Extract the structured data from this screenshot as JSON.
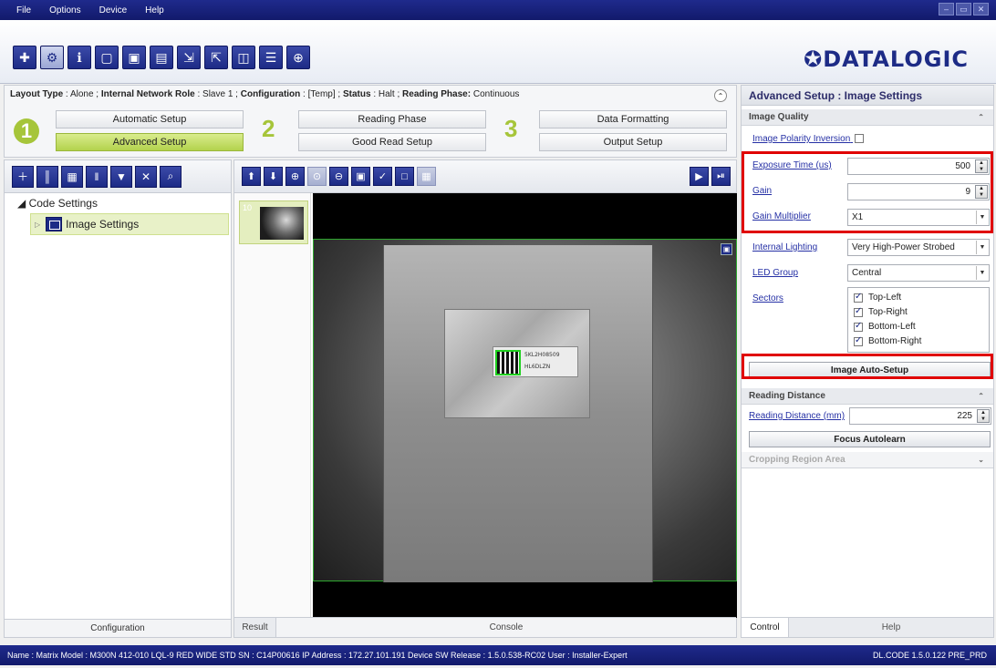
{
  "menu": [
    "File",
    "Options",
    "Device",
    "Help"
  ],
  "brand": {
    "logo": "✪DATALOGIC",
    "color": "#1d2b86",
    "accent": "#a6c53a"
  },
  "toolbar": {
    "icons": [
      "crosshair-icon",
      "settings-icon",
      "info-icon",
      "window-icon",
      "monitor-icon",
      "monitor-settings-icon",
      "export-icon",
      "import-icon",
      "device-icon",
      "network-icon",
      "target-icon"
    ]
  },
  "info": {
    "layout_type_label": "Layout Type",
    "layout_type": "Alone",
    "network_role_label": "Internal Network Role",
    "network_role": "Slave 1",
    "configuration_label": "Configuration",
    "configuration": "[Temp]",
    "status_label": "Status",
    "status": "Halt",
    "reading_phase_label": "Reading Phase:",
    "reading_phase": "Continuous"
  },
  "wizard": {
    "step1": "1",
    "step2": "2",
    "step3": "3",
    "automatic_setup": "Automatic Setup",
    "advanced_setup": "Advanced Setup",
    "reading_phase": "Reading Phase",
    "good_read_setup": "Good Read Setup",
    "data_formatting": "Data Formatting",
    "output_setup": "Output Setup"
  },
  "tree": {
    "root": "Code Settings",
    "item": "Image Settings",
    "footer": "Configuration"
  },
  "image_panel": {
    "thumb_number": "10",
    "label_line1": "5KL2H08509",
    "label_line2": "HL6DLZN",
    "result_tab": "Result",
    "console_tab": "Console"
  },
  "right": {
    "title": "Advanced Setup : Image Settings",
    "image_quality": "Image Quality",
    "polarity": "Image Polarity Inversion",
    "exposure_label": "Exposure Time (us)",
    "exposure_value": "500",
    "gain_label": "Gain",
    "gain_value": "9",
    "gain_multiplier_label": "Gain Multiplier",
    "gain_multiplier_value": "X1",
    "internal_lighting_label": "Internal Lighting",
    "internal_lighting_value": "Very High-Power Strobed",
    "led_group_label": "LED Group",
    "led_group_value": "Central",
    "sectors_label": "Sectors",
    "sectors": [
      "Top-Left",
      "Top-Right",
      "Bottom-Left",
      "Bottom-Right"
    ],
    "auto_setup": "Image Auto-Setup",
    "reading_distance": "Reading Distance",
    "reading_distance_label": "Reading Distance (mm)",
    "reading_distance_value": "225",
    "focus_autolearn": "Focus Autolearn",
    "cropping": "Cropping Region Area",
    "control_tab": "Control",
    "help_tab": "Help"
  },
  "status": {
    "text": "Name : Matrix  Model : M300N 412-010 LQL-9 RED WIDE STD   SN : C14P00616   IP Address : 172.27.101.191   Device SW Release : 1.5.0.538-RC02   User : Installer-Expert",
    "version": "DL.CODE 1.5.0.122 PRE_PRD"
  }
}
